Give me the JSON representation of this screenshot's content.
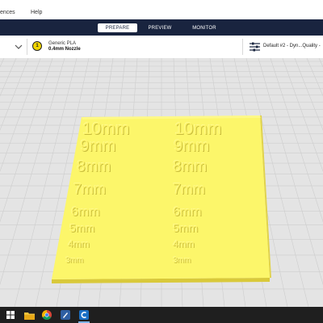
{
  "menu": {
    "preferences_partial": "ences",
    "help": "Help"
  },
  "stages": [
    {
      "label": "PREPARE",
      "active": true
    },
    {
      "label": "PREVIEW",
      "active": false
    },
    {
      "label": "MONITOR",
      "active": false
    }
  ],
  "extruder": {
    "number": "1",
    "material": "Generic PLA",
    "nozzle": "0.4mm Nozzle",
    "color": "#f2d600"
  },
  "print_settings": {
    "profile": "Default #2 - Dyn...Quality -",
    "icon": "sliders-icon"
  },
  "model": {
    "color": "#fcf66a",
    "labels_left": [
      "10mm",
      "9mm",
      "8mm",
      "7mm",
      "6mm",
      "5mm",
      "4mm",
      "3mm"
    ],
    "labels_right": [
      "10mm",
      "9mm",
      "8mm",
      "7mm",
      "6mm",
      "5mm",
      "4mm",
      "3mm"
    ]
  },
  "taskbar": {
    "apps": [
      {
        "name": "windows-start-icon"
      },
      {
        "name": "file-explorer-icon"
      },
      {
        "name": "chrome-icon"
      },
      {
        "name": "cura-app-icon"
      },
      {
        "name": "cura-active-icon",
        "active": true
      }
    ]
  },
  "colors": {
    "stagebar": "#19243f",
    "taskbar": "#1f1f1f",
    "grid_bg": "#e4e4e4",
    "grid_line": "#cfcfcf"
  }
}
